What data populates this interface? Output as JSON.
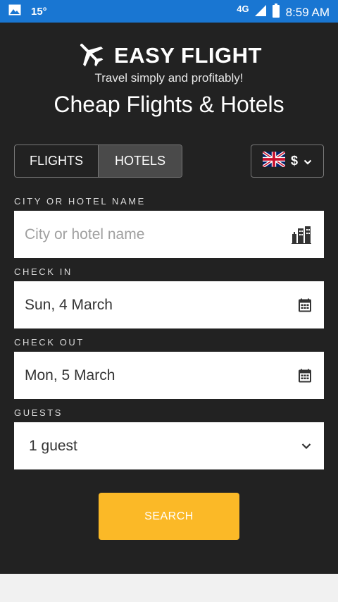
{
  "status_bar": {
    "temperature": "15°",
    "network": "4G",
    "time": "8:59 AM",
    "icons": [
      "gallery-icon",
      "signal-icon",
      "battery-icon"
    ]
  },
  "header": {
    "app_name": "EASY FLIGHT",
    "tagline": "Travel simply and profitably!",
    "headline": "Cheap Flights & Hotels",
    "logo_icon": "airplane-icon"
  },
  "tabs": [
    {
      "label": "FLIGHTS",
      "active": false
    },
    {
      "label": "HOTELS",
      "active": true
    }
  ],
  "currency": {
    "symbol": "$",
    "flag": "uk-flag-icon"
  },
  "form": {
    "city": {
      "label": "CITY OR HOTEL NAME",
      "placeholder": "City or hotel name",
      "icon": "city-icon"
    },
    "check_in": {
      "label": "CHECK IN",
      "value": "Sun, 4 March",
      "icon": "calendar-icon"
    },
    "check_out": {
      "label": "CHECK OUT",
      "value": "Mon, 5 March",
      "icon": "calendar-icon"
    },
    "guests": {
      "label": "GUESTS",
      "value": "1 guest",
      "icon": "chevron-down-icon"
    },
    "search_label": "SEARCH"
  },
  "colors": {
    "status_bar": "#1976d2",
    "background": "#222222",
    "accent": "#fbb927"
  }
}
